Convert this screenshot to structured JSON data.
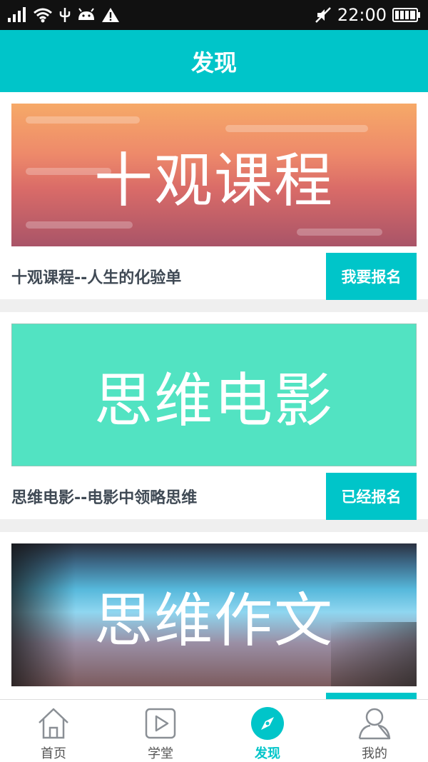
{
  "status_bar": {
    "time": "22:00",
    "left_icons": [
      "signal-icon",
      "wifi-icon",
      "usb-icon",
      "android-icon",
      "warning-icon"
    ],
    "right_icons": [
      "mute-icon",
      "battery-icon"
    ]
  },
  "header": {
    "title": "发现"
  },
  "colors": {
    "accent": "#00c5c9",
    "text_dark": "#404a55"
  },
  "cards": [
    {
      "banner_text": "十观课程",
      "title": "十观课程--人生的化验单",
      "button_label": "我要报名"
    },
    {
      "banner_text": "思维电影",
      "title": "思维电影--电影中领略思维",
      "button_label": "已经报名"
    },
    {
      "banner_text": "思维作文",
      "title": "",
      "button_label": ""
    }
  ],
  "bottom_nav": {
    "items": [
      {
        "label": "首页",
        "icon": "home-icon"
      },
      {
        "label": "学堂",
        "icon": "play-icon"
      },
      {
        "label": "发现",
        "icon": "compass-icon",
        "active": true
      },
      {
        "label": "我的",
        "icon": "profile-icon"
      }
    ]
  }
}
